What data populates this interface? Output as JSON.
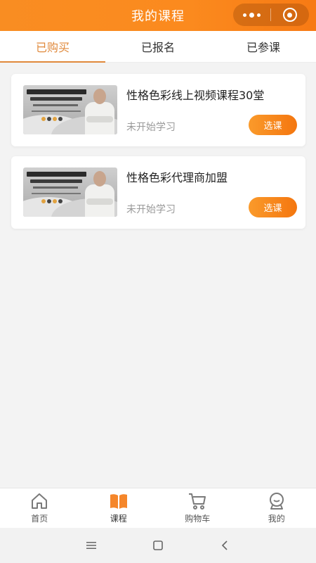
{
  "header": {
    "title": "我的课程",
    "more_icon": "more-dots-icon",
    "close_icon": "capsule-target-icon",
    "accent_color": "#f98d22"
  },
  "tabs": [
    {
      "label": "已购买",
      "active": true
    },
    {
      "label": "已报名",
      "active": false
    },
    {
      "label": "已参课",
      "active": false
    }
  ],
  "courses": [
    {
      "title": "性格色彩线上视频课程30堂",
      "status": "未开始学习",
      "button": "选课",
      "thumbnail_icon": "course-cover-image"
    },
    {
      "title": "性格色彩代理商加盟",
      "status": "未开始学习",
      "button": "选课",
      "thumbnail_icon": "course-cover-image"
    }
  ],
  "bottom_nav": [
    {
      "label": "首页",
      "icon": "home-icon",
      "active": false
    },
    {
      "label": "课程",
      "icon": "book-icon",
      "active": true
    },
    {
      "label": "购物车",
      "icon": "cart-icon",
      "active": false
    },
    {
      "label": "我的",
      "icon": "profile-icon",
      "active": false
    }
  ],
  "system_nav": [
    {
      "icon": "menu-icon"
    },
    {
      "icon": "home-square-icon"
    },
    {
      "icon": "back-icon"
    }
  ]
}
